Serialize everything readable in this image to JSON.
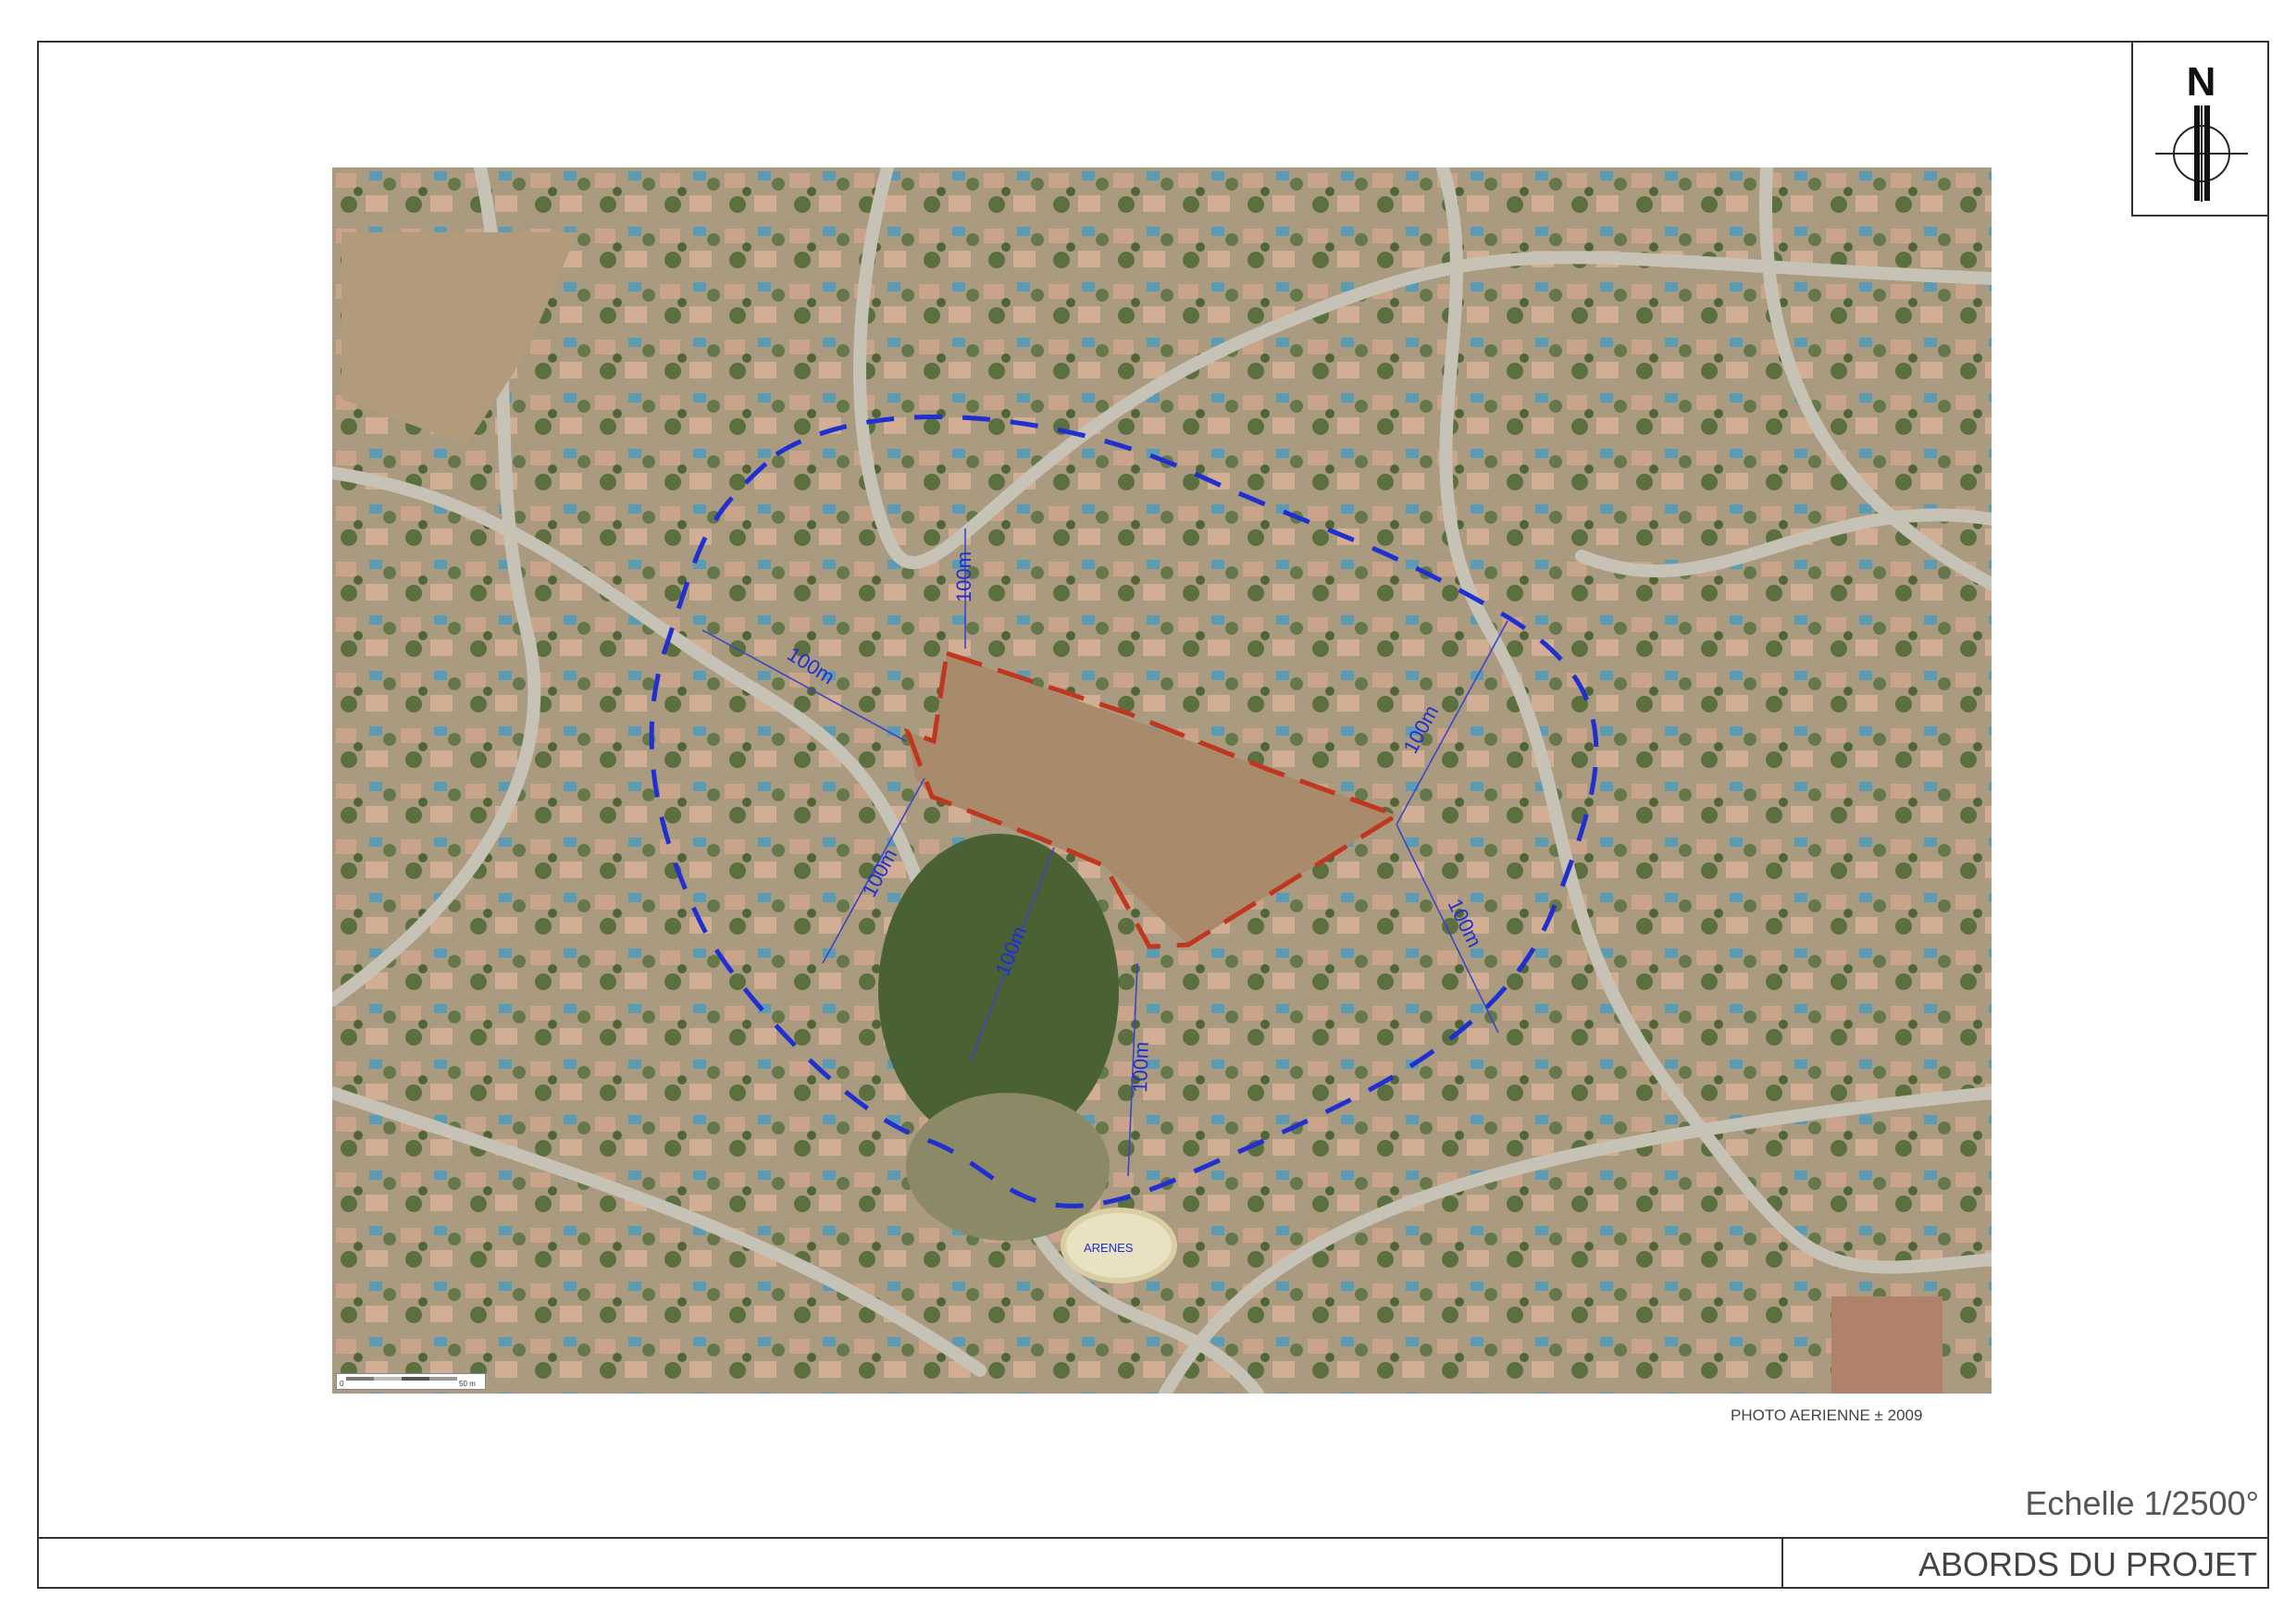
{
  "north": {
    "label": "N",
    "icon": "north-arrow-icon"
  },
  "map": {
    "distance_labels": [
      "100m",
      "100m",
      "100m",
      "100m",
      "100m",
      "100m",
      "100m"
    ],
    "place_label": "ARENES",
    "scalebar": {
      "start": "0",
      "end": "50 m"
    },
    "colors": {
      "parcel_outline": "#c0361f",
      "buffer": "#1f2fd0",
      "ground": "#b59a7d",
      "field": "#a98b6c"
    }
  },
  "photo_caption": "PHOTO AERIENNE ± 2009",
  "scale_text": "Echelle 1/2500°",
  "title": "ABORDS DU PROJET"
}
